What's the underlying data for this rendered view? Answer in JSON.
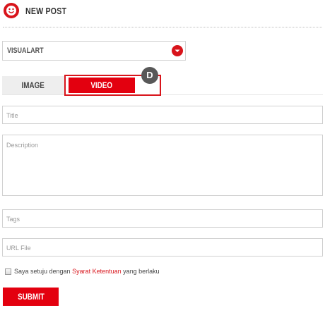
{
  "header": {
    "logo_icon": "smiley-icon",
    "title": "NEW POST"
  },
  "category_select": {
    "value": "VISUALART",
    "button_icon": "chevron-down-icon"
  },
  "tabs": [
    {
      "label": "IMAGE",
      "active": false
    },
    {
      "label": "VIDEO",
      "active": true
    }
  ],
  "badge": "D",
  "fields": {
    "title_placeholder": "Title",
    "description_placeholder": "Description",
    "tags_placeholder": "Tags",
    "url_placeholder": "URL File"
  },
  "agreement": {
    "checked": false,
    "text_before": "Saya setuju dengan ",
    "link_text": "Syarat Ketentuan",
    "text_after": " yang berlaku"
  },
  "submit_label": "SUBMIT",
  "colors": {
    "brand_red": "#e3000f",
    "badge_grey": "#585858",
    "border_grey": "#d0d0d0"
  }
}
